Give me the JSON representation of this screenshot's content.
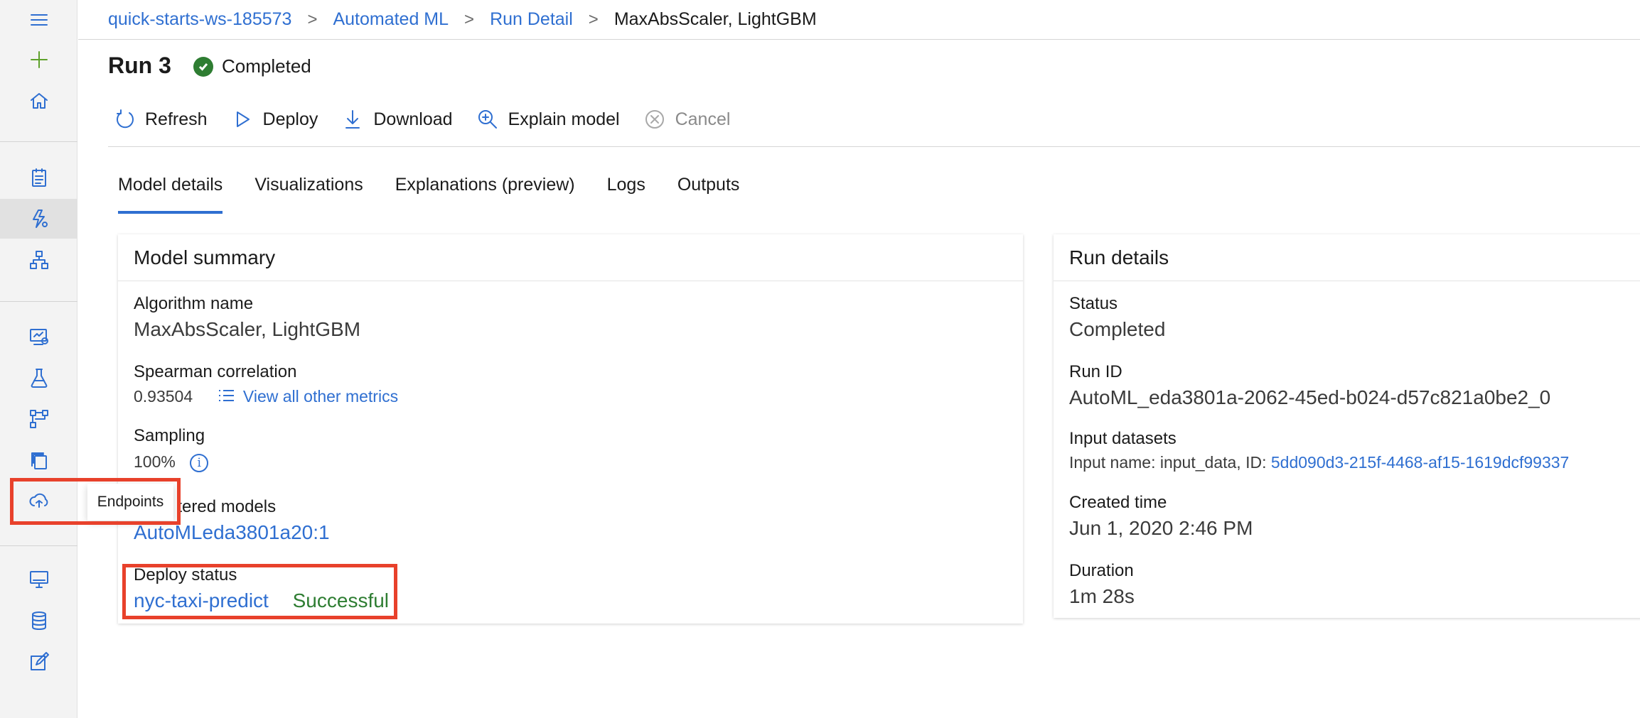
{
  "breadcrumb": {
    "items": [
      "quick-starts-ws-185573",
      "Automated ML",
      "Run Detail"
    ],
    "current": "MaxAbsScaler, LightGBM",
    "separator": ">"
  },
  "header": {
    "title": "Run 3",
    "status": "Completed"
  },
  "toolbar": {
    "refresh": "Refresh",
    "deploy": "Deploy",
    "download": "Download",
    "explain": "Explain model",
    "cancel": "Cancel"
  },
  "tabs": [
    "Model details",
    "Visualizations",
    "Explanations (preview)",
    "Logs",
    "Outputs"
  ],
  "sidebar": {
    "icons": [
      "menu-icon",
      "add-icon",
      "home-icon",
      "notebook-icon",
      "automl-icon",
      "designer-icon",
      "datasets-icon",
      "experiments-icon",
      "pipelines-icon",
      "models-icon",
      "endpoints-icon",
      "compute-icon",
      "datastores-icon",
      "labeling-icon"
    ],
    "tooltip": "Endpoints"
  },
  "model_summary": {
    "heading": "Model summary",
    "algorithm_label": "Algorithm name",
    "algorithm_value": "MaxAbsScaler, LightGBM",
    "metric_label": "Spearman correlation",
    "metric_value": "0.93504",
    "metrics_link": "View all other metrics",
    "sampling_label": "Sampling",
    "sampling_value": "100%",
    "registered_label": "Registered models",
    "registered_visible": "tered models",
    "registered_value": "AutoMLeda3801a20:1",
    "deploy_label": "Deploy status",
    "deploy_endpoint": "nyc-taxi-predict",
    "deploy_state": "Successful"
  },
  "run_details": {
    "heading": "Run details",
    "status_label": "Status",
    "status_value": "Completed",
    "runid_label": "Run ID",
    "runid_value": "AutoML_eda3801a-2062-45ed-b024-d57c821a0be2_0",
    "inputs_label": "Input datasets",
    "inputs_prefix": "Input name: input_data, ID:",
    "inputs_id": "5dd090d3-215f-4468-af15-1619dcf99337",
    "created_label": "Created time",
    "created_value": "Jun 1, 2020 2:46 PM",
    "duration_label": "Duration",
    "duration_value": "1m 28s"
  },
  "colors": {
    "accent": "#2f6fd1",
    "success": "#2e7d32",
    "highlight": "#e8412b"
  }
}
